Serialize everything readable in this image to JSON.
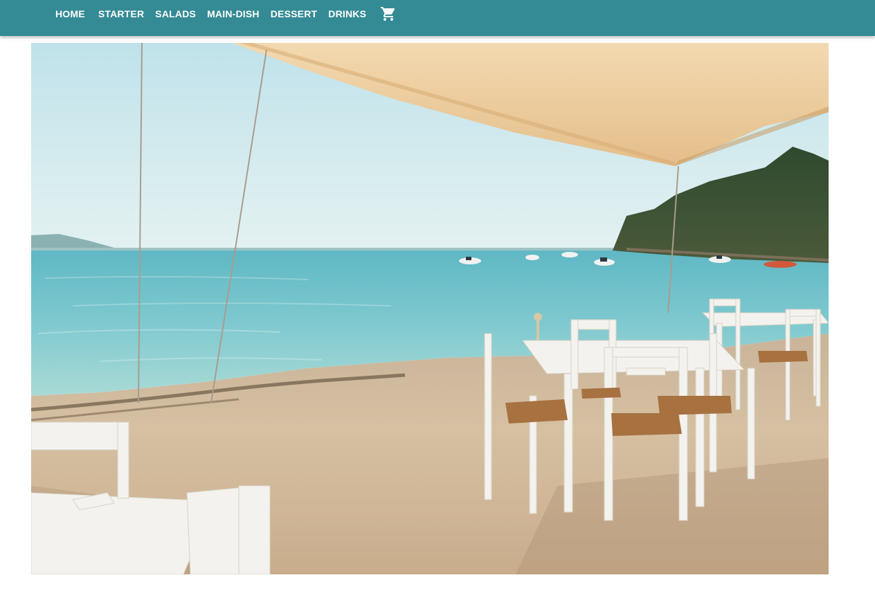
{
  "nav": {
    "items": [
      {
        "label": "HOME"
      },
      {
        "label": "STARTER"
      },
      {
        "label": "SALADS"
      },
      {
        "label": "MAIN-DISH"
      },
      {
        "label": "DESSERT"
      },
      {
        "label": "DRINKS"
      }
    ],
    "cart_icon": "shopping-cart-icon"
  },
  "colors": {
    "navbar": "#348b95",
    "nav_text": "#ffffff"
  },
  "hero": {
    "icon": "beach-restaurant-photo"
  }
}
